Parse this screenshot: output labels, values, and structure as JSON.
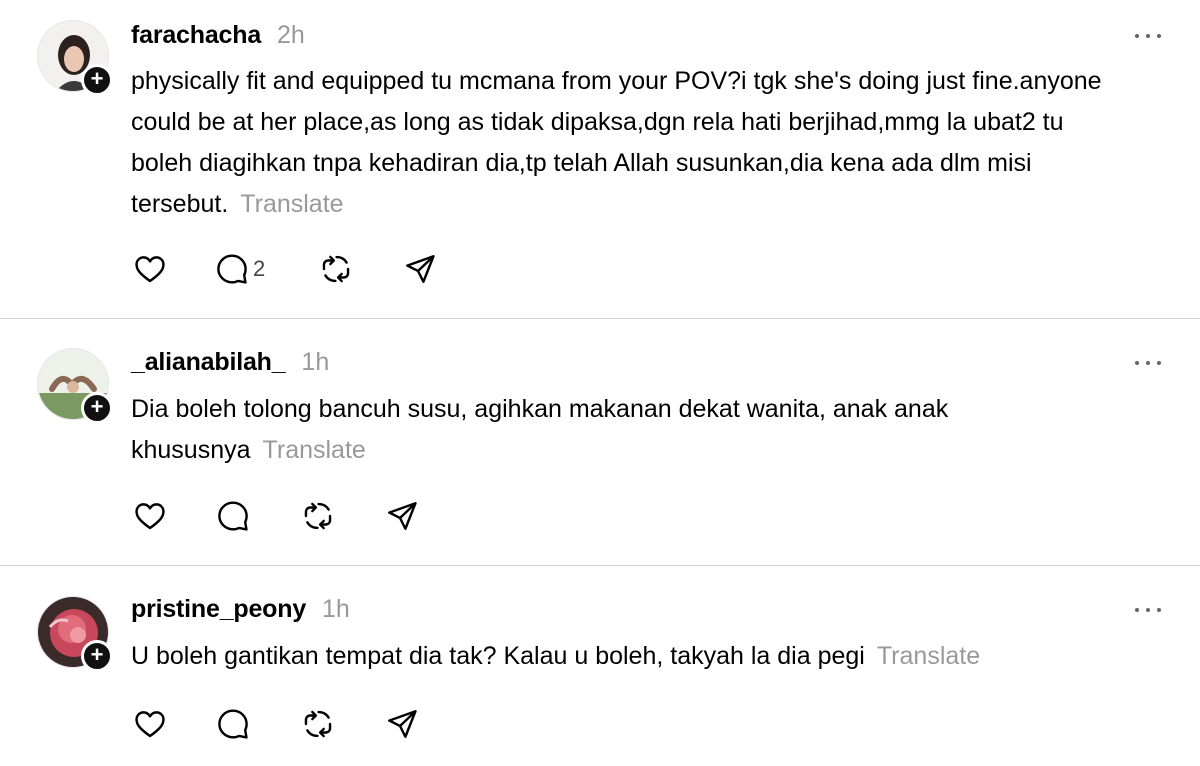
{
  "posts": [
    {
      "username": "farachacha",
      "time": "2h",
      "text": "physically fit and equipped tu mcmana from your POV?i tgk she's doing just fine.anyone could be at her place,as long as tidak dipaksa,dgn rela hati berjihad,mmg la ubat2 tu boleh diagihkan tnpa kehadiran dia,tp telah Allah susunkan,dia kena ada dlm misi tersebut.",
      "translate": "Translate",
      "reply_count": "2"
    },
    {
      "username": "_alianabilah_",
      "time": "1h",
      "text": "Dia boleh tolong bancuh susu, agihkan makanan dekat wanita, anak anak khususnya",
      "translate": "Translate",
      "reply_count": ""
    },
    {
      "username": "pristine_peony",
      "time": "1h",
      "text": "U boleh gantikan tempat dia tak? Kalau u boleh, takyah la dia pegi",
      "translate": "Translate",
      "reply_count": ""
    }
  ],
  "colors": {
    "text": "#000000",
    "muted": "#999999",
    "divider": "#d0d0d0",
    "follow_badge": "#111111"
  },
  "icons": [
    "heart-icon",
    "comment-icon",
    "repost-icon",
    "share-icon",
    "more-icon",
    "plus-icon"
  ]
}
